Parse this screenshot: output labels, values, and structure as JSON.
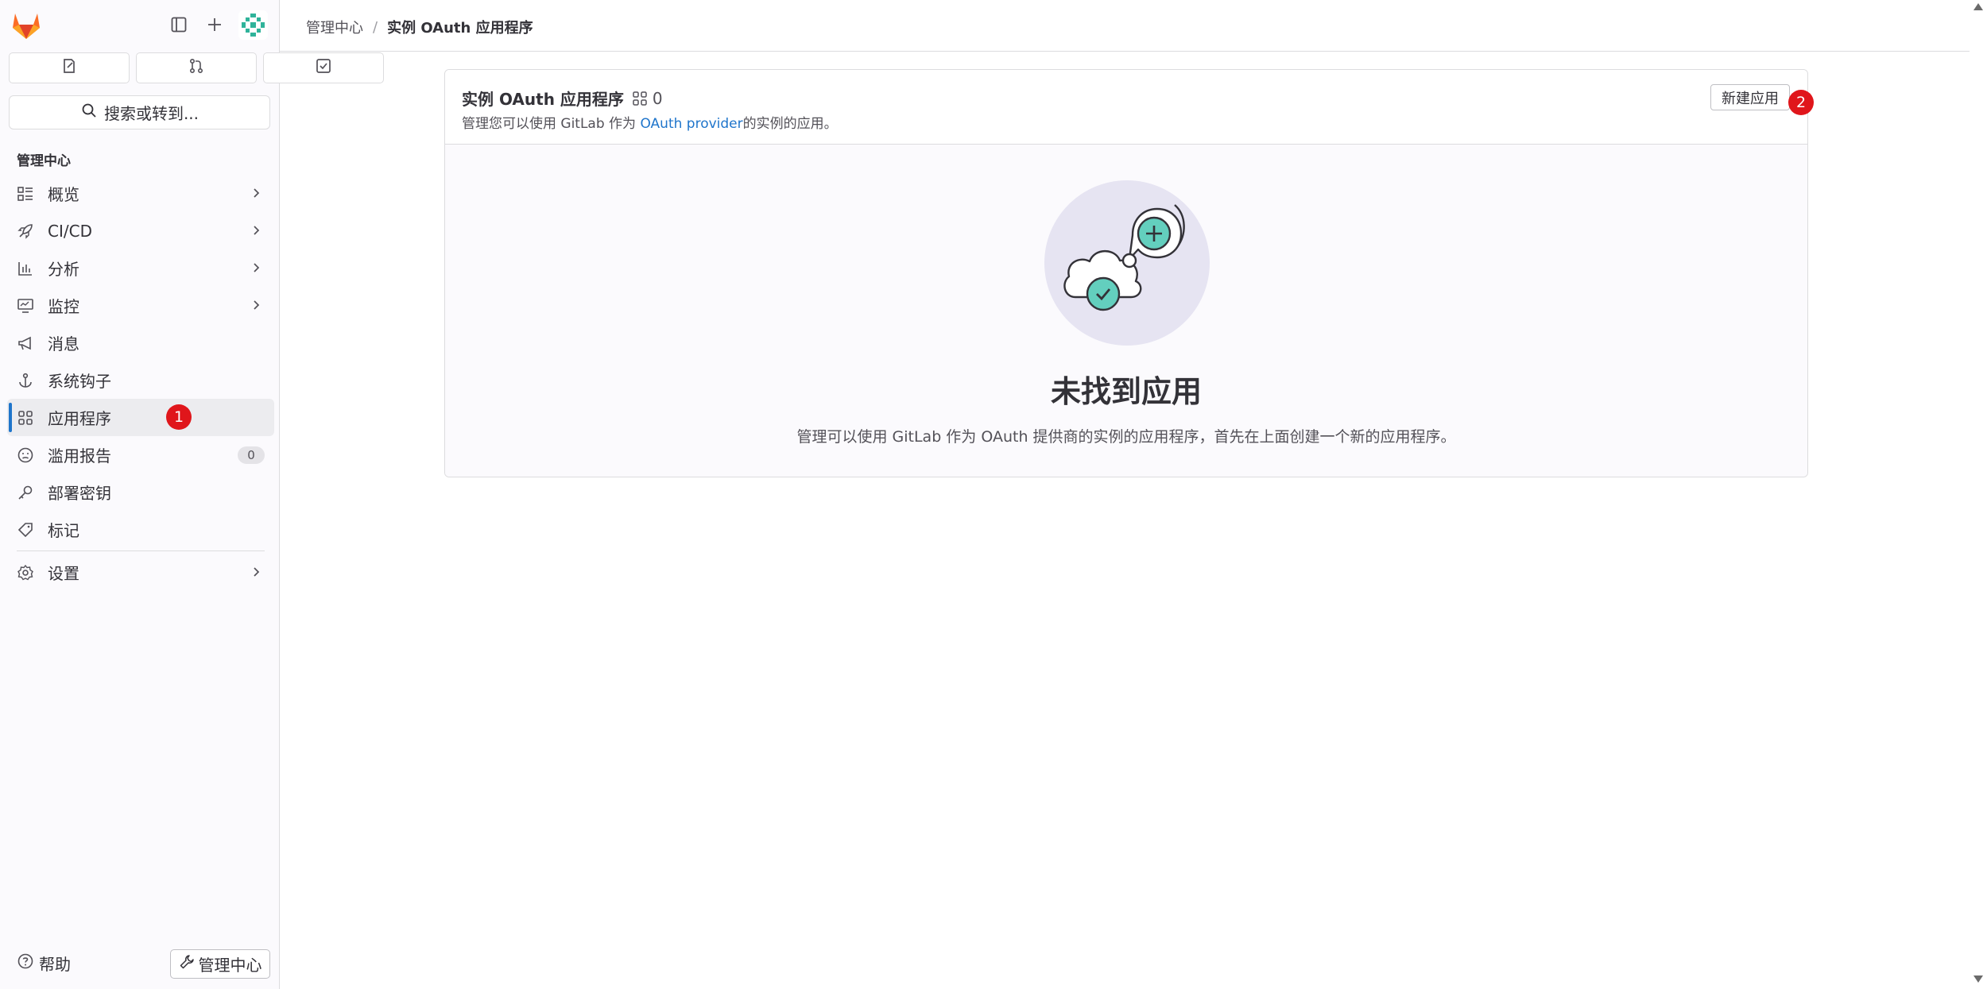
{
  "sidebar": {
    "search_label": "搜索或转到...",
    "section_title": "管理中心",
    "items": [
      {
        "label": "概览"
      },
      {
        "label": "CI/CD"
      },
      {
        "label": "分析"
      },
      {
        "label": "监控"
      },
      {
        "label": "消息"
      },
      {
        "label": "系统钩子"
      },
      {
        "label": "应用程序"
      },
      {
        "label": "滥用报告",
        "count": "0"
      },
      {
        "label": "部署密钥"
      },
      {
        "label": "标记"
      },
      {
        "label": "设置"
      }
    ],
    "active_item": "应用程序",
    "help_label": "帮助",
    "admin_button_label": "管理中心"
  },
  "annotations": {
    "badge1": "1",
    "badge2": "2"
  },
  "breadcrumb": {
    "items": [
      "管理中心",
      "实例 OAuth 应用程序"
    ],
    "separator": "/"
  },
  "card": {
    "title": "实例 OAuth 应用程序",
    "count": "0",
    "desc_before": "管理您可以使用 GitLab 作为 ",
    "desc_link": "OAuth provider",
    "desc_after": "的实例的应用。",
    "new_button_label": "新建应用"
  },
  "empty_state": {
    "title": "未找到应用",
    "description": "管理可以使用 GitLab 作为 OAuth 提供商的实例的应用程序，首先在上面创建一个新的应用程序。"
  },
  "colors": {
    "accent": "#1f75cb",
    "badge_red": "#e0161b",
    "illustration_teal": "#63cfbe",
    "illustration_bg": "#e6e4f2"
  }
}
